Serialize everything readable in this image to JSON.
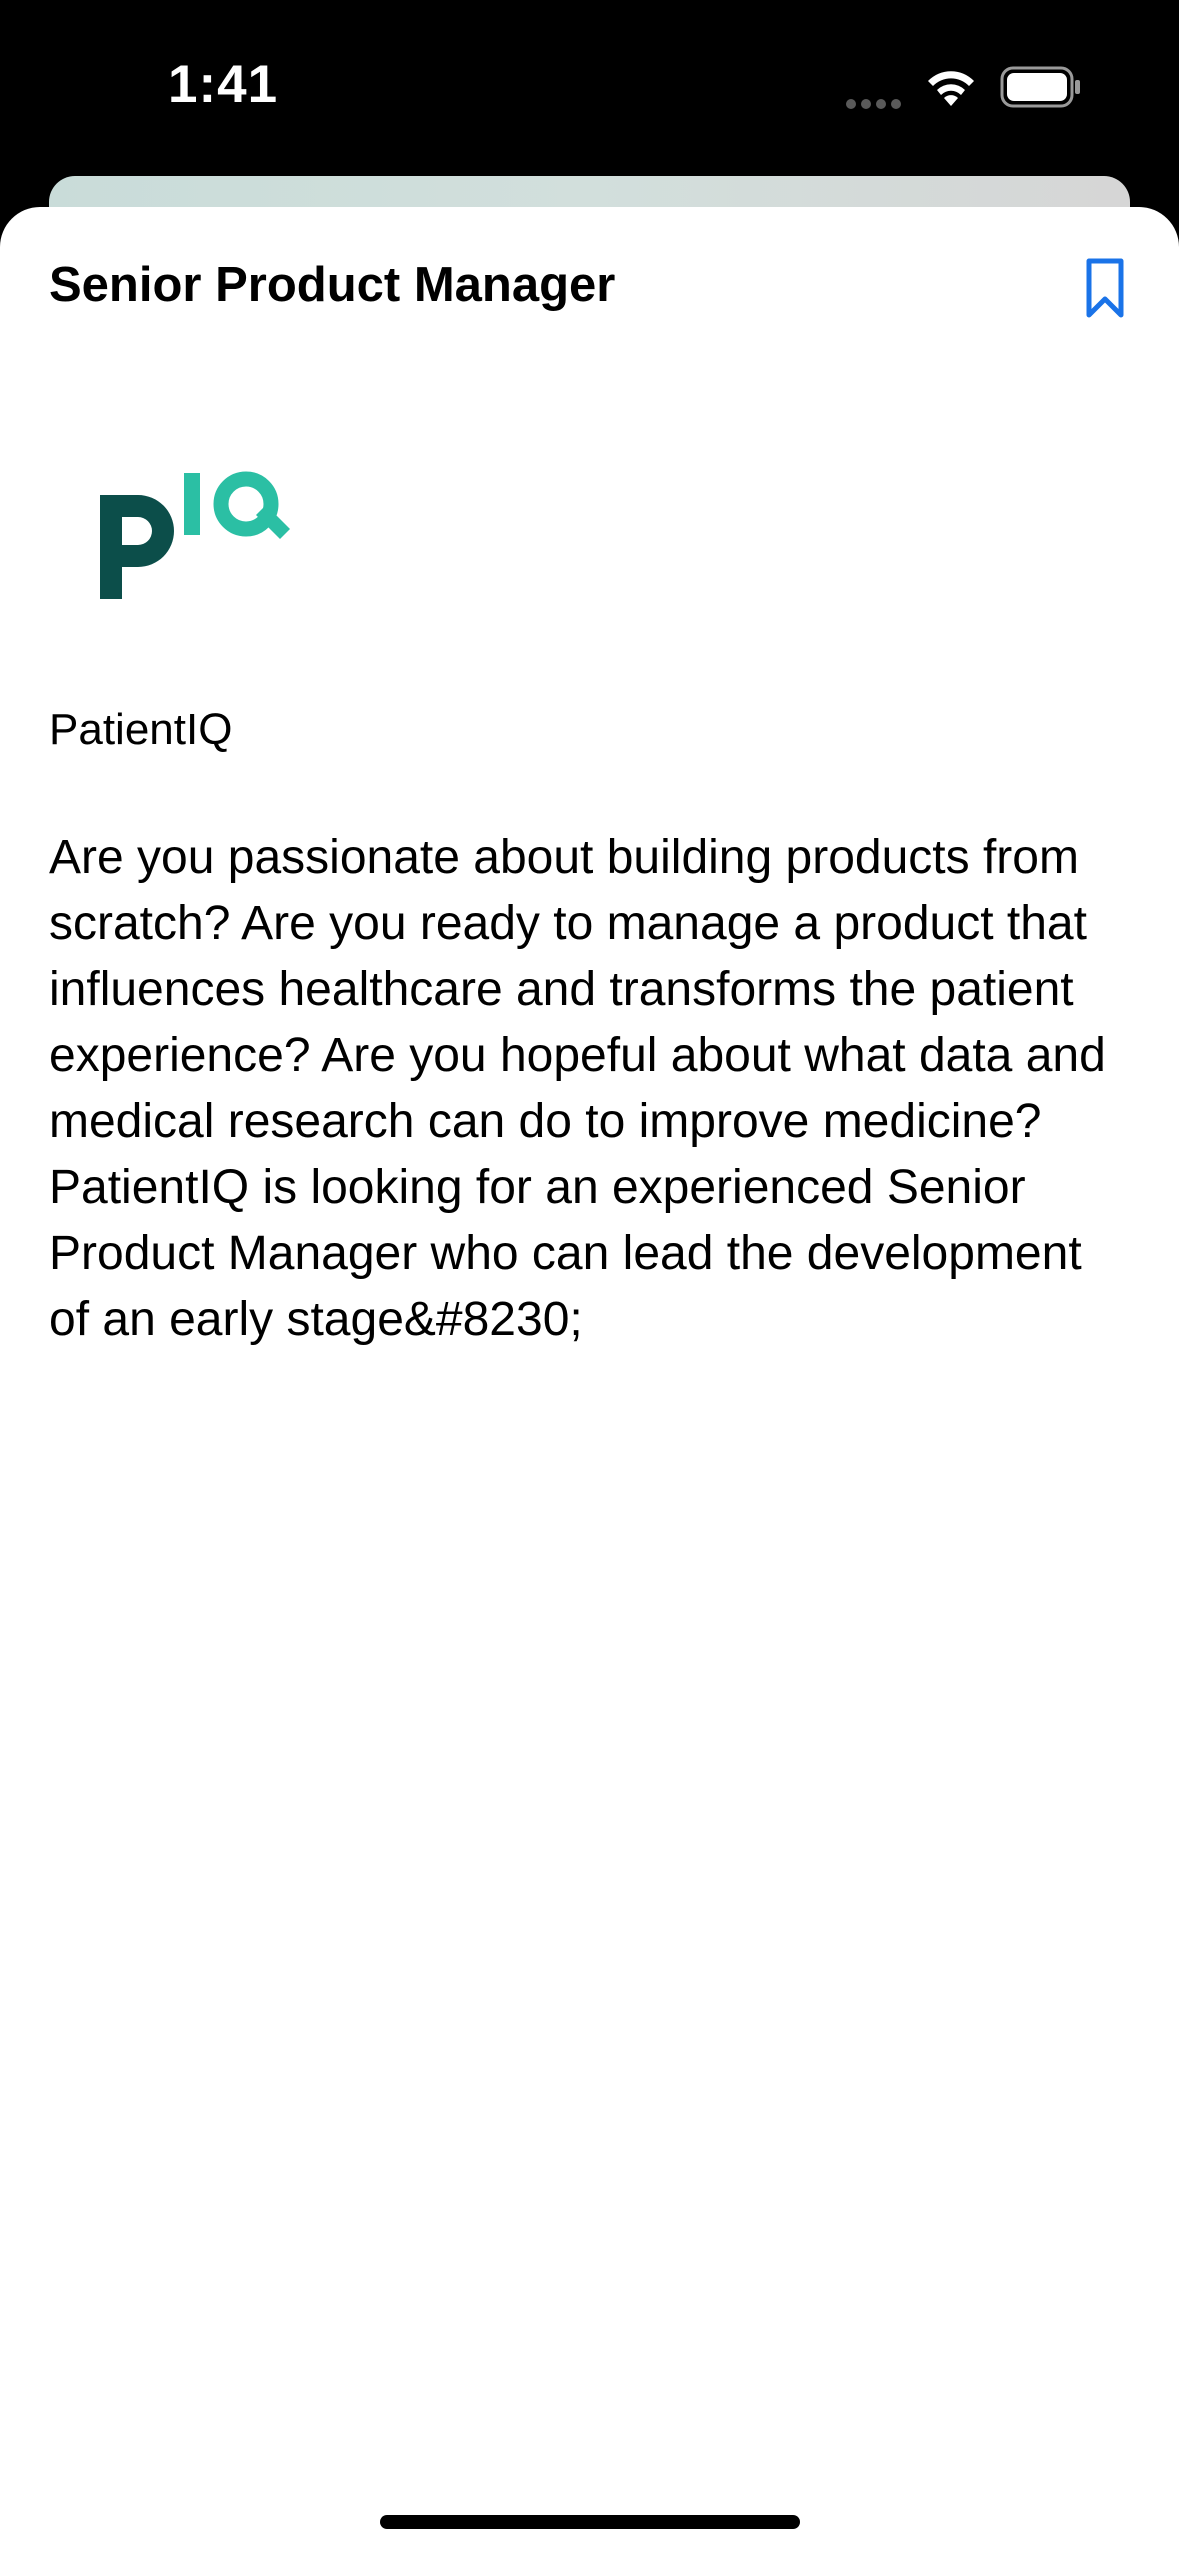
{
  "status_bar": {
    "time": "1:41",
    "icons": [
      "signal-dots-icon",
      "wifi-icon",
      "battery-icon"
    ]
  },
  "job": {
    "title": "Senior Product Manager",
    "company": "PatientIQ",
    "logo_text": "pIQ",
    "description": "Are you passionate about building products from scratch? Are you ready to manage a product that influences healthcare and transforms the patient experience? Are you hopeful about what data and medical research can do to improve medicine? PatientIQ is looking for an experienced Senior Product Manager who can lead the development of an early stage&#8230;"
  },
  "colors": {
    "accent": "#1a73e8",
    "logo_dark": "#0c4e4a",
    "logo_light": "#2bbfa4"
  }
}
